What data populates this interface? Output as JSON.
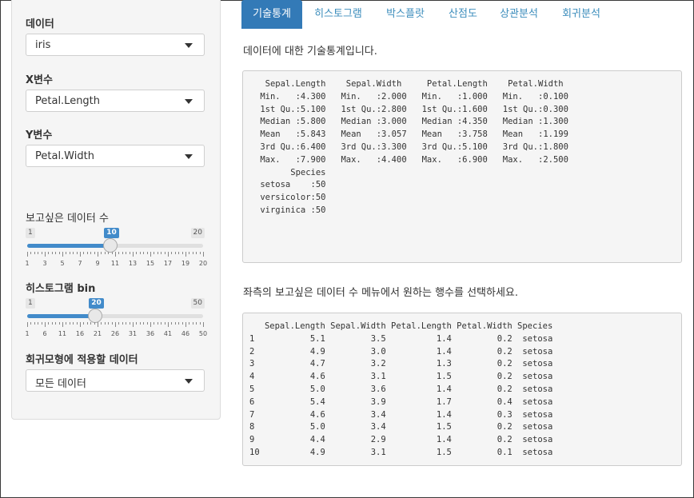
{
  "sidebar": {
    "data_label": "데이터",
    "data_value": "iris",
    "x_label": "X변수",
    "x_value": "Petal.Length",
    "y_label": "Y변수",
    "y_value": "Petal.Width",
    "rows_label": "보고싶은 데이터 수",
    "rows_slider": {
      "min": 1,
      "max": 20,
      "value": 10,
      "min_label": "1",
      "max_label": "20",
      "value_label": "10",
      "tick_labels": [
        "1",
        "3",
        "5",
        "7",
        "9",
        "11",
        "13",
        "15",
        "17",
        "19",
        "20"
      ]
    },
    "bin_label": "히스토그램 bin",
    "bin_slider": {
      "min": 1,
      "max": 50,
      "value": 20,
      "min_label": "1",
      "max_label": "50",
      "value_label": "20",
      "tick_labels": [
        "1",
        "6",
        "11",
        "16",
        "21",
        "26",
        "31",
        "36",
        "41",
        "46",
        "50"
      ]
    },
    "model_label": "회귀모형에 적용할 데이터",
    "model_value": "모든 데이터"
  },
  "tabs": [
    "기술통계",
    "히스토그램",
    "박스플랏",
    "산점도",
    "상관분석",
    "회귀분석"
  ],
  "active_tab": 0,
  "summary_desc": "데이터에 대한 기술통계입니다.",
  "summary_text": "  Sepal.Length    Sepal.Width     Petal.Length    Petal.Width   \n Min.   :4.300   Min.   :2.000   Min.   :1.000   Min.   :0.100  \n 1st Qu.:5.100   1st Qu.:2.800   1st Qu.:1.600   1st Qu.:0.300  \n Median :5.800   Median :3.000   Median :4.350   Median :1.300  \n Mean   :5.843   Mean   :3.057   Mean   :3.758   Mean   :1.199  \n 3rd Qu.:6.400   3rd Qu.:3.300   3rd Qu.:5.100   3rd Qu.:1.800  \n Max.   :7.900   Max.   :4.400   Max.   :6.900   Max.   :2.500  \n       Species  \n setosa    :50  \n versicolor:50  \n virginica :50  ",
  "head_desc": "좌측의 보고싶은 데이터 수 메뉴에서 원하는 행수를 선택하세요.",
  "head_text": "   Sepal.Length Sepal.Width Petal.Length Petal.Width Species\n1           5.1         3.5          1.4         0.2  setosa\n2           4.9         3.0          1.4         0.2  setosa\n3           4.7         3.2          1.3         0.2  setosa\n4           4.6         3.1          1.5         0.2  setosa\n5           5.0         3.6          1.4         0.2  setosa\n6           5.4         3.9          1.7         0.4  setosa\n7           4.6         3.4          1.4         0.3  setosa\n8           5.0         3.4          1.5         0.2  setosa\n9           4.4         2.9          1.4         0.2  setosa\n10          4.9         3.1          1.5         0.1  setosa"
}
